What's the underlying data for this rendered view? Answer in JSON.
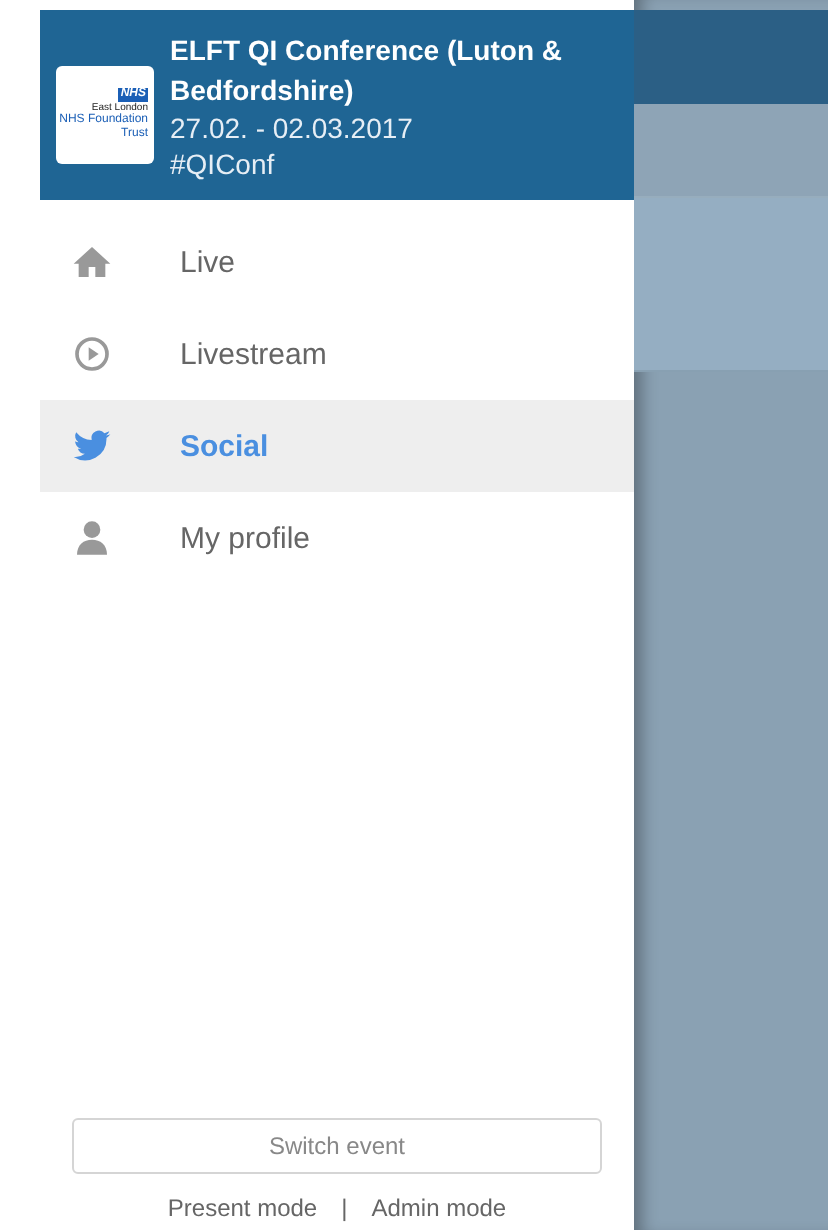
{
  "event": {
    "logo": {
      "badge": "NHS",
      "name": "East London",
      "subtitle": "NHS Foundation Trust"
    },
    "title": "ELFT QI Conference (Luton & Bedfordshire)",
    "dates": "27.02. - 02.03.2017",
    "hashtag": "#QIConf"
  },
  "menu": [
    {
      "kind": "home",
      "label": "Live",
      "selected": false
    },
    {
      "kind": "play",
      "label": "Livestream",
      "selected": false
    },
    {
      "kind": "bird",
      "label": "Social",
      "selected": true
    },
    {
      "kind": "person",
      "label": "My profile",
      "selected": false
    }
  ],
  "switch_button": "Switch event",
  "modes": [
    "Present mode",
    "Admin mode"
  ],
  "separator": "|"
}
